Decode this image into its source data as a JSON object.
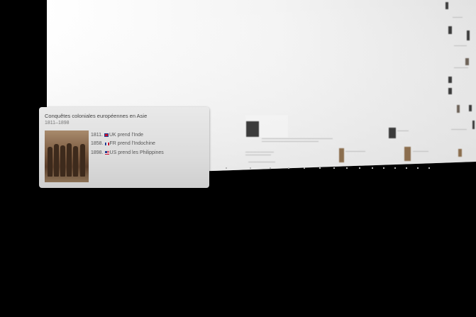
{
  "timeline": {
    "card": {
      "title": "Conquêtes coloniales européennes en Asie",
      "dates": "1811–1898",
      "events": [
        {
          "year": "1811.",
          "flag": "uk-flag-icon",
          "text": "UK prend l'Inde"
        },
        {
          "year": "1858.",
          "flag": "fr-flag-icon",
          "text": "FR prend l'Indochine"
        },
        {
          "year": "1898.",
          "flag": "us-flag-icon",
          "text": "US prend les Philippines"
        }
      ]
    }
  },
  "colors": {
    "background": "#000000",
    "plane": "#ffffff",
    "card": "#dcdcdc"
  }
}
